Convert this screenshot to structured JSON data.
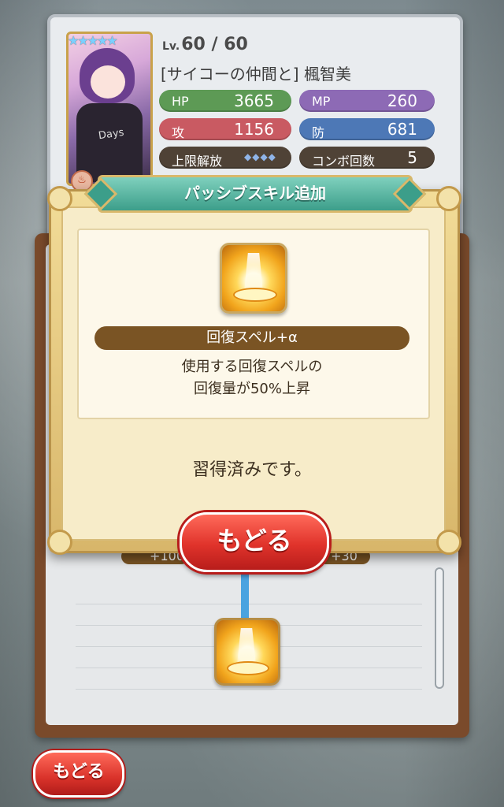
{
  "character": {
    "level_prefix": "Lv.",
    "level": "60 / 60",
    "name": "[サイコーの仲間と] 楓智美",
    "stars": "★★★★★",
    "shirt_text": "Days"
  },
  "stats": {
    "hp_label": "HP",
    "hp_value": "3665",
    "mp_label": "MP",
    "mp_value": "260",
    "atk_label": "攻",
    "atk_value": "1156",
    "def_label": "防",
    "def_value": "681",
    "limit_label": "上限解放",
    "limit_gems": "◆◆◆◆",
    "combo_label": "コンボ回数",
    "combo_value": "5"
  },
  "dialog": {
    "title": "パッシブスキル追加",
    "skill_name": "回復スペル+α",
    "skill_desc_line1": "使用する回復スペルの",
    "skill_desc_line2": "回復量が50%上昇",
    "status_text": "習得済みです。",
    "back_label": "もどる"
  },
  "tree": {
    "left_bonus": "+100",
    "right_bonus": "+30"
  },
  "footer": {
    "back_label": "もどる"
  },
  "icons": {
    "fire": "fire-icon",
    "skill": "heal-spell-icon"
  },
  "colors": {
    "hp": "#5d9a55",
    "mp": "#8d6ab5",
    "atk": "#c95a62",
    "def": "#4d78b6",
    "dialog_title": "#3c9e8a",
    "back_button": "#e0332b"
  }
}
